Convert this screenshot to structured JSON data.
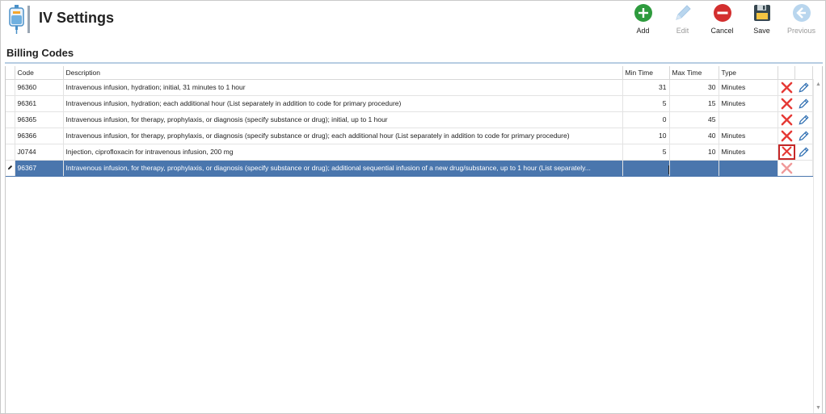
{
  "app": {
    "title": "IV Settings"
  },
  "toolbar": {
    "add": "Add",
    "edit": "Edit",
    "cancel": "Cancel",
    "save": "Save",
    "previous": "Previous"
  },
  "section": {
    "title": "Billing Codes"
  },
  "grid": {
    "columns": [
      "Code",
      "Description",
      "Min Time",
      "Max Time",
      "Type"
    ],
    "rows": [
      {
        "code": "96360",
        "description": "Intravenous infusion, hydration; initial, 31 minutes to 1 hour",
        "min": "31",
        "max": "30",
        "type": "Minutes"
      },
      {
        "code": "96361",
        "description": "Intravenous infusion, hydration; each additional hour (List separately in addition to code for primary procedure)",
        "min": "5",
        "max": "15",
        "type": "Minutes"
      },
      {
        "code": "96365",
        "description": "Intravenous infusion, for therapy, prophylaxis, or diagnosis (specify substance or drug); initial, up to 1 hour",
        "min": "0",
        "max": "45",
        "type": ""
      },
      {
        "code": "96366",
        "description": "Intravenous infusion, for therapy, prophylaxis, or diagnosis (specify substance or drug); each additional hour (List separately in addition to code for primary procedure)",
        "min": "10",
        "max": "40",
        "type": "Minutes"
      },
      {
        "code": "J0744",
        "description": "Injection, ciprofloxacin for intravenous infusion, 200 mg",
        "min": "5",
        "max": "10",
        "type": "Minutes"
      },
      {
        "code": "96367",
        "description": "Intravenous infusion, for therapy, prophylaxis, or diagnosis (specify substance or drug); additional sequential infusion of a new drug/substance, up to 1 hour (List separately...",
        "min": "",
        "max": "",
        "type": ""
      }
    ]
  },
  "colors": {
    "accent": "#4a76ad",
    "add": "#2e9b3e",
    "cancel": "#d32f2f",
    "delete": "#e53935",
    "edit_icon": "#2b6cb0"
  }
}
